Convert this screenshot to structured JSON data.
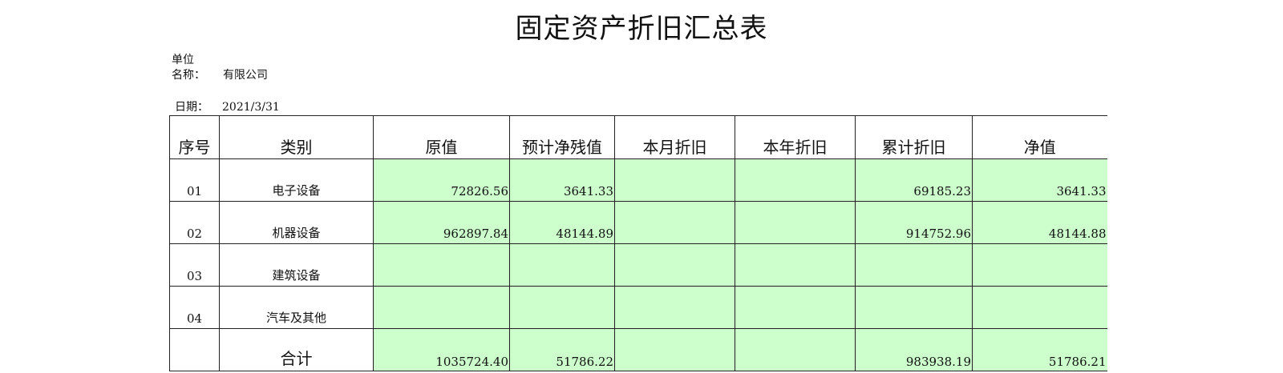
{
  "title": "固定资产折旧汇总表",
  "meta": {
    "unit_label_line1": "单位",
    "unit_label_line2": "名称：",
    "company": "有限公司",
    "date_label": "日期：",
    "date_value": "2021/3/31"
  },
  "table": {
    "headers": [
      "序号",
      "类别",
      "原值",
      "预计净残值",
      "本月折旧",
      "本年折旧",
      "累计折旧",
      "净值"
    ],
    "rows": [
      {
        "no": "01",
        "category": "电子设备",
        "original": "72826.56",
        "residual": "3641.33",
        "month_dep": "",
        "year_dep": "",
        "accum_dep": "69185.23",
        "net": "3641.33"
      },
      {
        "no": "02",
        "category": "机器设备",
        "original": "962897.84",
        "residual": "48144.89",
        "month_dep": "",
        "year_dep": "",
        "accum_dep": "914752.96",
        "net": "48144.88"
      },
      {
        "no": "03",
        "category": "建筑设备",
        "original": "",
        "residual": "",
        "month_dep": "",
        "year_dep": "",
        "accum_dep": "",
        "net": ""
      },
      {
        "no": "04",
        "category": "汽车及其他",
        "original": "",
        "residual": "",
        "month_dep": "",
        "year_dep": "",
        "accum_dep": "",
        "net": ""
      }
    ],
    "total": {
      "label": "合计",
      "original": "1035724.40",
      "residual": "51786.22",
      "month_dep": "",
      "year_dep": "",
      "accum_dep": "983938.19",
      "net": "51786.21"
    }
  }
}
